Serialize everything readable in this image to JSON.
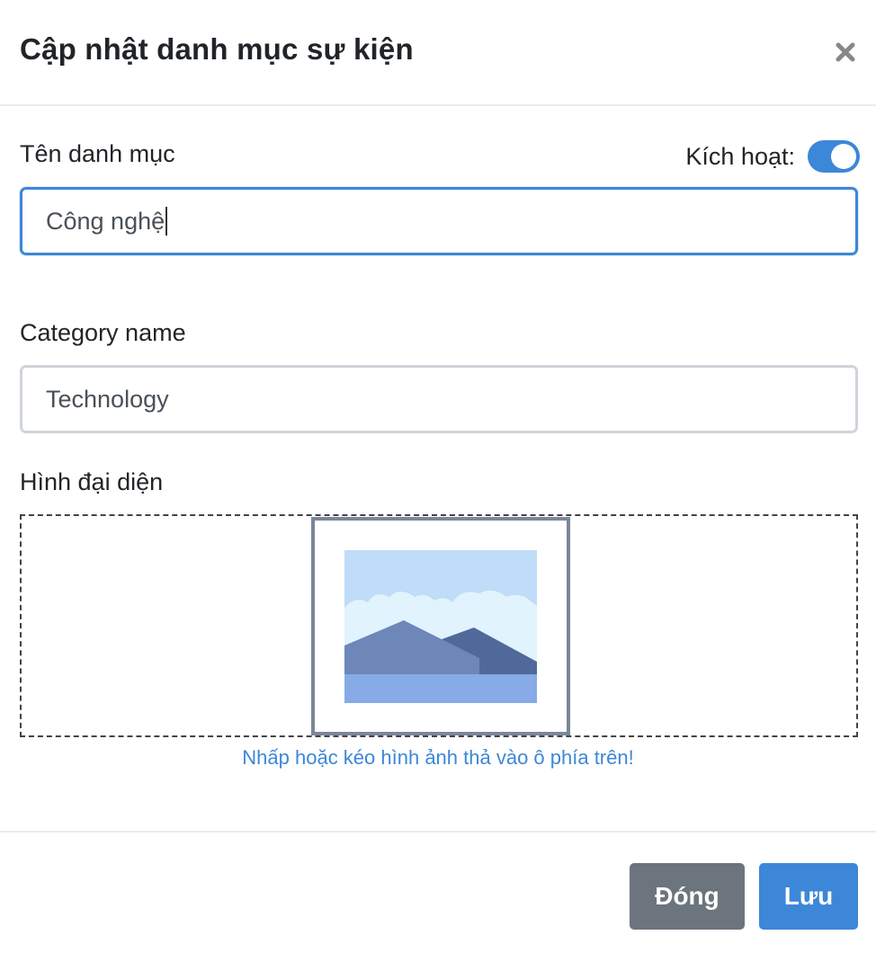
{
  "modal": {
    "title": "Cập nhật danh mục sự kiện"
  },
  "form": {
    "category_name_vi": {
      "label": "Tên danh mục",
      "value": "Công nghệ"
    },
    "active": {
      "label": "Kích hoạt:",
      "checked": true
    },
    "category_name_en": {
      "label": "Category name",
      "value": "Technology"
    },
    "image": {
      "label": "Hình đại diện",
      "hint": "Nhấp hoặc kéo hình ảnh thả vào ô phía trên!"
    }
  },
  "footer": {
    "close_label": "Đóng",
    "save_label": "Lưu"
  },
  "colors": {
    "primary": "#3d87d8",
    "secondary": "#6c757d"
  }
}
